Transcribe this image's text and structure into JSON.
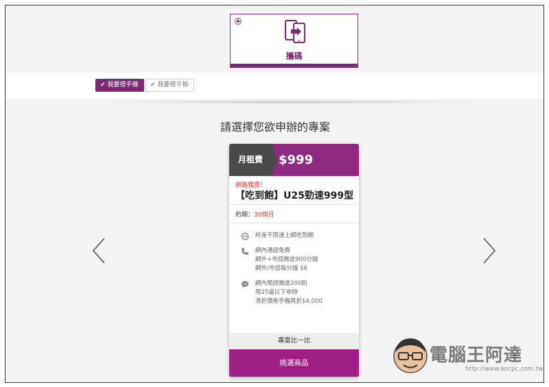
{
  "device_option": {
    "label": "攜碼",
    "selected": true
  },
  "tabs": [
    {
      "label": "我要搭手機",
      "active": true
    },
    {
      "label": "我要搭平板",
      "active": false
    }
  ],
  "headline": "請選擇您欲申辦的專案",
  "plan": {
    "fee_label": "月租費",
    "price": "$999",
    "tag": "網路獨賣！",
    "name": "【吃到飽】U25勁速999型",
    "term_label": "約期：",
    "term_value": "30個月",
    "features": [
      {
        "icon": "globe-icon",
        "lines": [
          "終身不限速上網吃到飽"
        ]
      },
      {
        "icon": "phone-icon",
        "lines": [
          "網內通話免費",
          "網外+市話贈送900分鐘",
          "網外/市話每分鐘 $6"
        ]
      },
      {
        "icon": "chat-bubble-icon",
        "lines": [
          "網內簡訊贈送200則",
          "限25歲以下申辦",
          "憑折價券手機再折$4,000"
        ]
      }
    ],
    "compare_label": "專案比一比",
    "select_label": "挑選商品"
  },
  "colors": {
    "brand_purple": "#7b2a73",
    "price_band": "#8e2a82",
    "select_button": "#a01f85",
    "fee_label_bg": "#4a4a4a",
    "highlight_red": "#e53935"
  },
  "watermark": {
    "title": "電腦王阿達",
    "url": "http://www.kocpc.com.tw"
  }
}
